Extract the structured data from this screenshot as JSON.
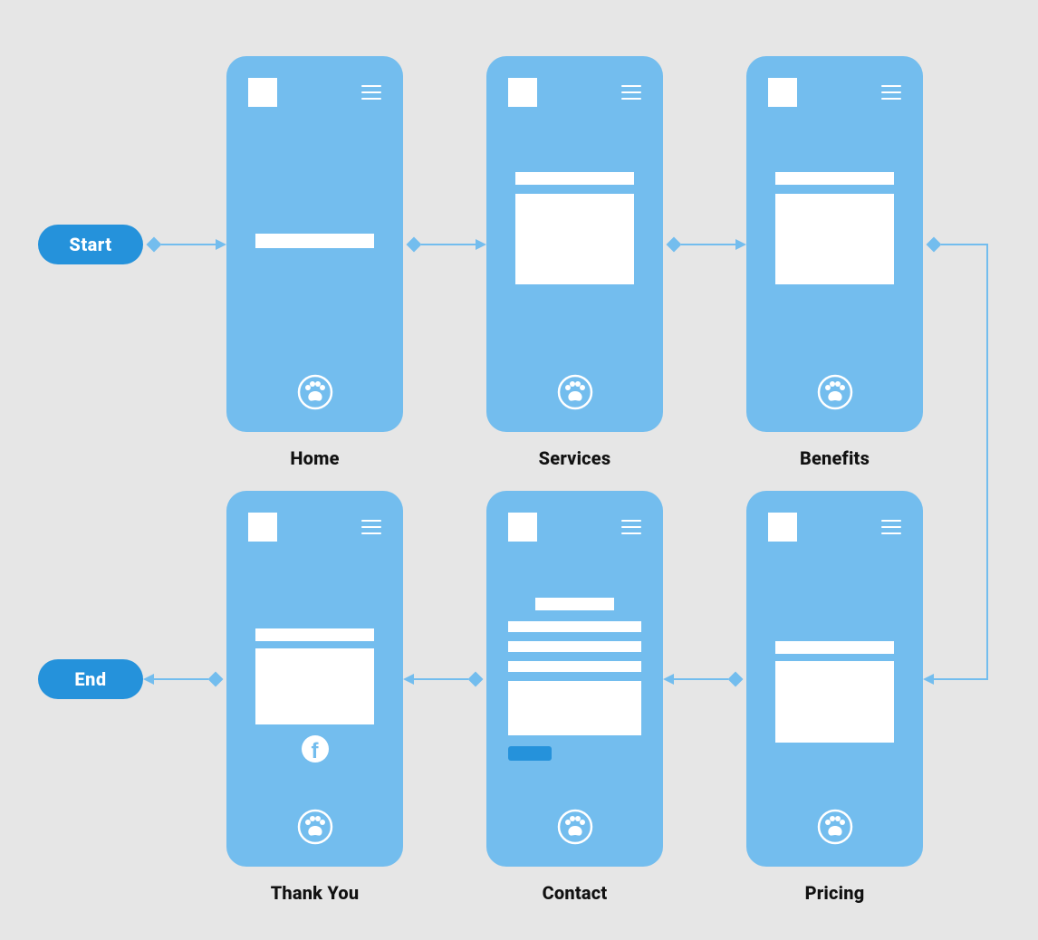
{
  "start_label": "Start",
  "end_label": "End",
  "screens": {
    "home": {
      "label": "Home"
    },
    "services": {
      "label": "Services"
    },
    "benefits": {
      "label": "Benefits"
    },
    "pricing": {
      "label": "Pricing"
    },
    "contact": {
      "label": "Contact"
    },
    "thankyou": {
      "label": "Thank You"
    }
  },
  "colors": {
    "bg": "#e6e6e6",
    "phone": "#73bdee",
    "accent": "#2592db",
    "white": "#ffffff"
  }
}
